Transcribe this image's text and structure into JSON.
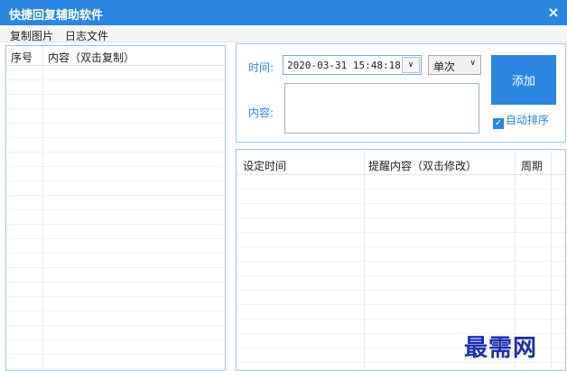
{
  "window": {
    "title": "快捷回复辅助软件",
    "close_glyph": "×"
  },
  "menu": {
    "items": [
      "复制图片",
      "日志文件"
    ]
  },
  "left_list": {
    "columns": [
      "序号",
      "内容（双击复制）"
    ]
  },
  "form": {
    "time_label": "时间:",
    "datetime_value": "2020-03-31 15:48:18",
    "datetime_dropdown": "∨",
    "repeat_value": "单次",
    "repeat_dropdown": "∨",
    "content_label": "内容:",
    "content_value": "",
    "add_button": "添加",
    "auto_sort_label": "自动排序",
    "auto_sort_checked": "✓"
  },
  "reminders": {
    "columns": [
      "设定时间",
      "提醒内容（双击修改）",
      "周期"
    ]
  },
  "watermark": "最需网"
}
